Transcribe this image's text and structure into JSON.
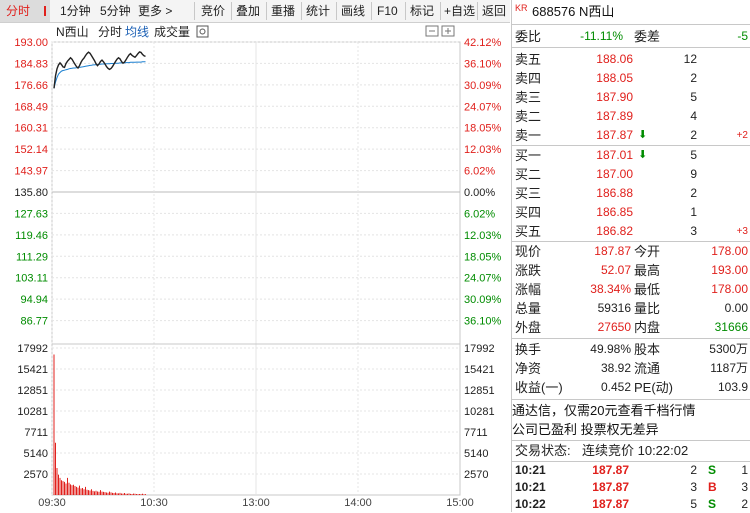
{
  "toolbar": {
    "tabs": [
      "分时",
      "1分钟",
      "5分钟",
      "更多 >"
    ],
    "buttons": [
      "竞价",
      "叠加",
      "重播",
      "统计",
      "画线",
      "F10",
      "标记",
      "+自选",
      "返回"
    ]
  },
  "chart": {
    "stock_name": "N西山",
    "legend_items": [
      "分时",
      "均线",
      "成交量"
    ],
    "left_price_labels": [
      "193.00",
      "184.83",
      "176.66",
      "168.49",
      "160.31",
      "152.14",
      "143.97",
      "135.80",
      "127.63",
      "119.46",
      "111.29",
      "103.11",
      "94.94",
      "86.77"
    ],
    "right_pct_labels": [
      "42.12%",
      "36.10%",
      "30.09%",
      "24.07%",
      "18.05%",
      "12.03%",
      "6.02%",
      "0.00%",
      "6.02%",
      "12.03%",
      "18.05%",
      "24.07%",
      "30.09%",
      "36.10%"
    ],
    "volume_labels": [
      "17992",
      "15421",
      "12851",
      "10281",
      "7711",
      "5140",
      "2570"
    ],
    "time_labels": [
      "09:30",
      "10:30",
      "13:00",
      "14:00",
      "15:00"
    ],
    "prev_close": 135.8,
    "price_series": [
      176.6,
      181.0,
      183.5,
      184.9,
      185.6,
      185.0,
      184.2,
      184.0,
      185.4,
      186.2,
      186.8,
      187.4,
      186.9,
      186.0,
      185.1,
      184.3,
      183.8,
      184.6,
      185.8,
      186.7,
      187.3,
      188.2,
      188.9,
      189.4,
      189.0,
      188.2,
      187.3,
      186.4,
      185.3,
      184.6,
      185.2,
      186.1,
      186.6,
      186.0,
      185.2,
      184.3,
      183.7,
      183.3,
      183.6,
      184.3,
      185.2,
      186.1,
      186.9,
      187.4,
      187.0,
      186.1,
      185.5,
      185.9,
      186.7,
      187.6,
      188.4,
      188.9,
      188.3,
      187.9,
      187.6,
      188.2,
      188.9,
      189.5,
      189.3,
      188.6,
      188.1,
      187.9
    ],
    "avg_series": [
      176.6,
      178.8,
      180.4,
      181.6,
      182.2,
      182.7,
      182.9,
      183.0,
      183.2,
      183.3,
      183.5,
      183.6,
      183.7,
      183.8,
      183.8,
      183.9,
      184.0,
      184.0,
      184.1,
      184.2,
      184.3,
      184.4,
      184.5,
      184.6,
      184.7,
      184.8,
      184.9,
      184.9,
      185.0,
      185.0,
      185.1,
      185.1,
      185.2,
      185.2,
      185.2,
      185.3,
      185.3,
      185.3,
      185.4,
      185.4,
      185.4,
      185.5,
      185.5,
      185.5,
      185.6,
      185.6,
      185.6,
      185.6,
      185.7,
      185.7,
      185.7,
      185.8,
      185.8,
      185.8,
      185.8,
      185.9,
      185.9,
      185.9,
      185.9,
      186.0,
      186.0,
      186.0
    ],
    "volume_series": [
      17200,
      6400,
      3300,
      2500,
      2100,
      1800,
      1700,
      1600,
      1400,
      2100,
      1500,
      1300,
      1200,
      1250,
      1100,
      1000,
      900,
      1150,
      800,
      850,
      700,
      1000,
      650,
      600,
      550,
      700,
      500,
      450,
      520,
      430,
      400,
      600,
      420,
      380,
      350,
      300,
      280,
      420,
      320,
      260,
      240,
      300,
      220,
      200,
      260,
      180,
      170,
      240,
      160,
      150,
      200,
      140,
      130,
      170,
      150,
      120,
      110,
      130,
      100,
      150,
      90,
      110
    ]
  },
  "quote": {
    "badge": "KR",
    "code_name": "688576 N西山",
    "weibi_label": "委比",
    "weibi_value": "-11.11%",
    "weicha_label": "委差",
    "weicha_value": "-5",
    "sells": [
      {
        "label": "卖五",
        "price": "188.06",
        "vol": "12",
        "chg": ""
      },
      {
        "label": "卖四",
        "price": "188.05",
        "vol": "2",
        "chg": ""
      },
      {
        "label": "卖三",
        "price": "187.90",
        "vol": "5",
        "chg": ""
      },
      {
        "label": "卖二",
        "price": "187.89",
        "vol": "4",
        "chg": ""
      },
      {
        "label": "卖一",
        "price": "187.87",
        "vol": "2",
        "chg": "+2",
        "arrow": "down"
      }
    ],
    "buys": [
      {
        "label": "买一",
        "price": "187.01",
        "vol": "5",
        "chg": "",
        "arrow": "down"
      },
      {
        "label": "买二",
        "price": "187.00",
        "vol": "9",
        "chg": ""
      },
      {
        "label": "买三",
        "price": "186.88",
        "vol": "2",
        "chg": ""
      },
      {
        "label": "买四",
        "price": "186.85",
        "vol": "1",
        "chg": ""
      },
      {
        "label": "买五",
        "price": "186.82",
        "vol": "3",
        "chg": "+3"
      }
    ],
    "stats1": [
      {
        "l1": "现价",
        "v1": "187.87",
        "c1": "red",
        "l2": "今开",
        "v2": "178.00",
        "c2": "red"
      },
      {
        "l1": "涨跌",
        "v1": "52.07",
        "c1": "red",
        "l2": "最高",
        "v2": "193.00",
        "c2": "red"
      },
      {
        "l1": "涨幅",
        "v1": "38.34%",
        "c1": "red",
        "l2": "最低",
        "v2": "178.00",
        "c2": "red"
      },
      {
        "l1": "总量",
        "v1": "59316",
        "c1": "black",
        "l2": "量比",
        "v2": "0.00",
        "c2": "black"
      },
      {
        "l1": "外盘",
        "v1": "27650",
        "c1": "red",
        "l2": "内盘",
        "v2": "31666",
        "c2": "green"
      }
    ],
    "stats2": [
      {
        "l1": "换手",
        "v1": "49.98%",
        "l2": "股本",
        "v2": "5300万"
      },
      {
        "l1": "净资",
        "v1": "38.92",
        "l2": "流通",
        "v2": "1187万"
      },
      {
        "l1": "收益(一)",
        "v1": "0.452",
        "l2": "PE(动)",
        "v2": "103.9"
      }
    ],
    "promo1": "通达信，仅需20元查看千档行情",
    "promo2": "公司已盈利 投票权无差异",
    "status_label": "交易状态:",
    "status_value": "连续竞价 10:22:02",
    "ticks": [
      {
        "time": "10:21",
        "price": "187.87",
        "vol": "2",
        "bs": "S",
        "n": "1"
      },
      {
        "time": "10:21",
        "price": "187.87",
        "vol": "3",
        "bs": "B",
        "n": "3"
      },
      {
        "time": "10:22",
        "price": "187.87",
        "vol": "5",
        "bs": "S",
        "n": "2"
      }
    ]
  }
}
